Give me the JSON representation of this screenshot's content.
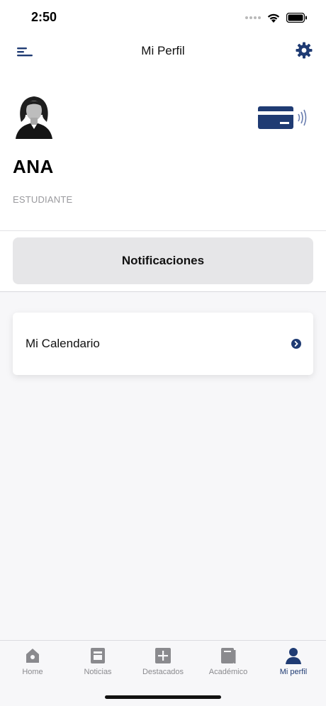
{
  "status_bar": {
    "time": "2:50"
  },
  "header": {
    "title": "Mi Perfil",
    "menu_icon": "menu-icon",
    "settings_icon": "gear-icon"
  },
  "profile": {
    "name": "ANA",
    "role": "ESTUDIANTE",
    "avatar_icon": "user-avatar",
    "card_icon": "contactless-card-icon"
  },
  "notifications": {
    "label": "Notificaciones"
  },
  "calendar": {
    "label": "Mi Calendario",
    "chevron_icon": "chevron-right-circle-icon"
  },
  "tabs": [
    {
      "label": "Home",
      "icon": "home-icon",
      "active": false
    },
    {
      "label": "Noticias",
      "icon": "news-icon",
      "active": false
    },
    {
      "label": "Destacados",
      "icon": "plus-square-icon",
      "active": false
    },
    {
      "label": "Académico",
      "icon": "book-icon",
      "active": false
    },
    {
      "label": "Mi perfil",
      "icon": "person-icon",
      "active": true
    }
  ],
  "colors": {
    "accent": "#1f3b73",
    "inactive_tab": "#8a8a8e",
    "button_bg": "#e6e6e8"
  }
}
